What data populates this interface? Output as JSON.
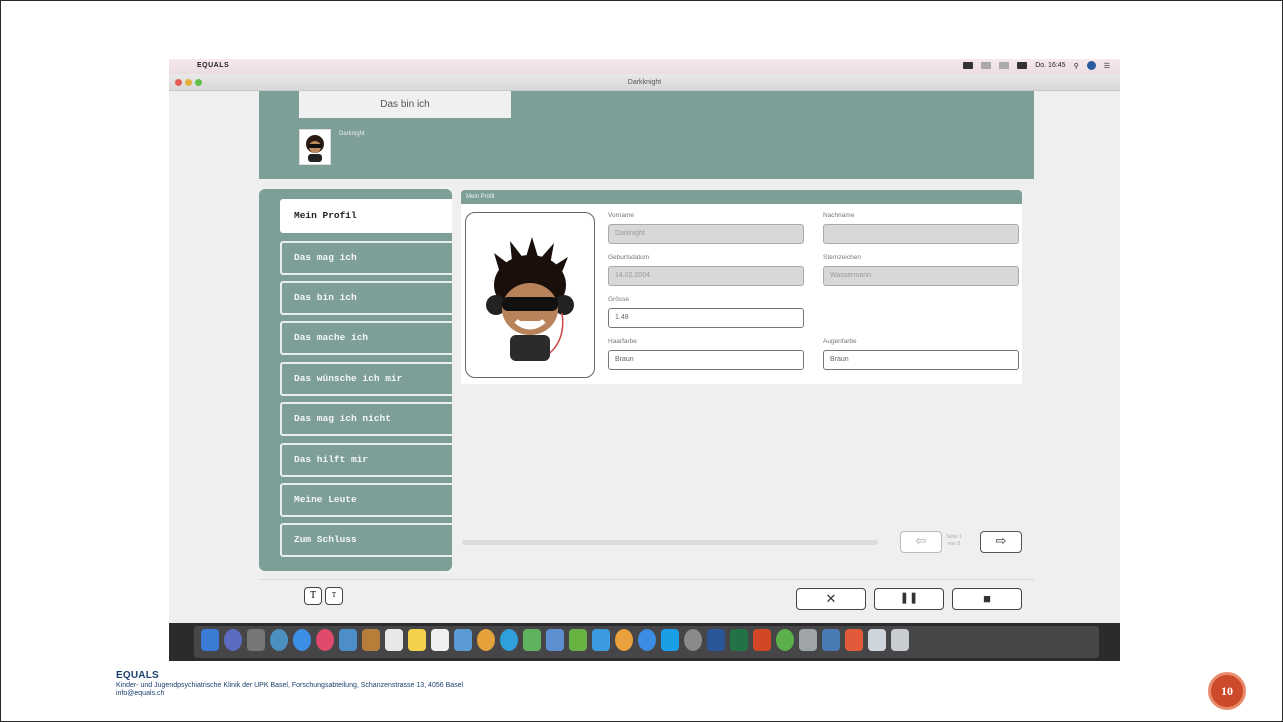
{
  "menubar": {
    "app_name": "EQUALS",
    "clock": "Do. 16:45"
  },
  "window": {
    "title": "Darkknight"
  },
  "header": {
    "tab_label": "Das bin ich",
    "username": "Darknight"
  },
  "sidebar": {
    "items": [
      {
        "label": "Mein Profil",
        "active": true
      },
      {
        "label": "Das mag ich",
        "active": false
      },
      {
        "label": "Das bin ich",
        "active": false
      },
      {
        "label": "Das mache ich",
        "active": false
      },
      {
        "label": "Das wünsche ich mir",
        "active": false
      },
      {
        "label": "Das mag ich nicht",
        "active": false
      },
      {
        "label": "Das hilft mir",
        "active": false
      },
      {
        "label": "Meine Leute",
        "active": false
      },
      {
        "label": "Zum Schluss",
        "active": false
      }
    ]
  },
  "profile": {
    "panel_title": "Mein Profil",
    "vorname": {
      "label": "Vorname",
      "value": "Darknight",
      "disabled": true
    },
    "nachname": {
      "label": "Nachname",
      "value": "",
      "disabled": true
    },
    "geburtsdatum": {
      "label": "Geburtsdatum",
      "value": "14.02.2004",
      "disabled": true
    },
    "sternzeichen": {
      "label": "Sternzeichen",
      "value": "Wassermann",
      "disabled": true
    },
    "groesse": {
      "label": "Grösse",
      "value": "1.48",
      "disabled": false
    },
    "haarfarbe": {
      "label": "Haarfarbe",
      "value": "Braun",
      "disabled": false
    },
    "augenfarbe": {
      "label": "Augenfarbe",
      "value": "Braun",
      "disabled": false
    }
  },
  "pagination": {
    "page_info_line1": "Seite 1",
    "page_info_line2": "von 8",
    "prev_icon": "arrow-left-icon",
    "next_icon": "arrow-right-icon"
  },
  "text_size": {
    "large": "T",
    "small": "T"
  },
  "actions": {
    "close": "✕",
    "pause": "❚❚",
    "stop": "■"
  },
  "footer": {
    "org": "EQUALS",
    "address": "Kinder- und Jugendpsychiatrische Klinik der UPK Basel, Forschungsabteilung, Schanzenstrasse 13, 4056 Basel",
    "email": "info@equals.ch"
  },
  "slide_number": "10",
  "colors": {
    "accent": "#7d9f97",
    "footer_text": "#1d3f6e",
    "badge": "#cc4a2a"
  }
}
